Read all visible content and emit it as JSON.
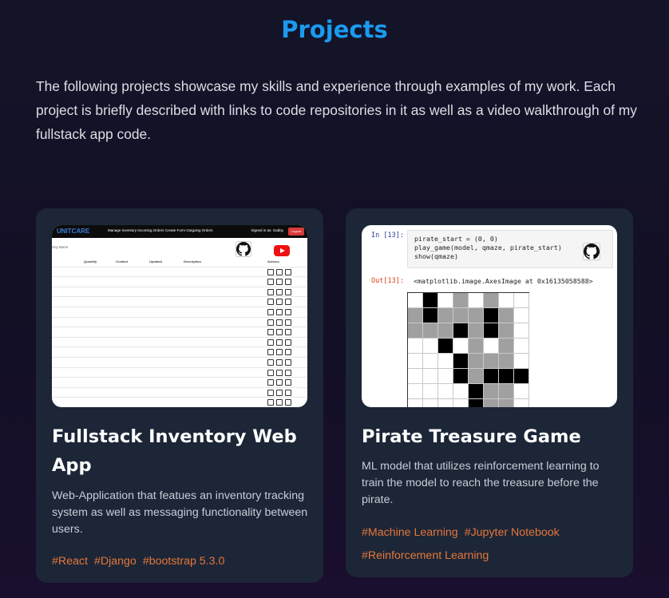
{
  "section": {
    "title": "Projects",
    "intro": "The following projects showcase my skills and experience through examples of my work. Each project is briefly described with links to code repositories in it as well as a video walkthrough of my fullstack app code."
  },
  "projects": [
    {
      "title": "Fullstack Inventory Web App",
      "description": "Web-Application that featues an inventory tracking system as well as messaging functionality between users.",
      "tags": [
        "#React",
        "#Django",
        "#bootstrap 5.3.0"
      ],
      "screenshot": {
        "logo": "UNITCARE",
        "nav_links": "Manage Inventory   Incoming Orders   Create Form   Outgoing Orders",
        "user": "Signed in as: Gabby",
        "logout": "Logout",
        "search": "Any Items",
        "columns": [
          "Quantity",
          "Created",
          "Updated",
          "Description",
          "Actions"
        ],
        "badges": [
          "github-icon",
          "youtube-icon"
        ]
      }
    },
    {
      "title": "Pirate Treasure Game",
      "description": "ML model that utilizes reinforcement learning to train the model to reach the treasure before the pirate.",
      "tags": [
        "#Machine Learning",
        "#Jupyter Notebook",
        "#Reinforcement Learning"
      ],
      "screenshot": {
        "in_prompt": "In [13]:",
        "code": "pirate_start = (0, 0)\nplay_game(model, qmaze, pirate_start)\nshow(qmaze)",
        "out_prompt": "Out[13]:",
        "output": "<matplotlib.image.AxesImage at 0x16135058588>",
        "maze": [
          "wkwgwgww",
          "gkgggkgw",
          "gggkgkgw",
          "wwkwgwgw",
          "wwwkgggw",
          "wwwkgkkk",
          "wwwwkggw",
          "wwwwkggw"
        ],
        "badges": [
          "github-icon"
        ]
      }
    }
  ],
  "colors": {
    "title": "#1a9bf0",
    "tag": "#e5763a",
    "card": "#1c2637",
    "maze_black": "#000000",
    "maze_gray": "#a0a0a0",
    "maze_white": "#ffffff"
  }
}
